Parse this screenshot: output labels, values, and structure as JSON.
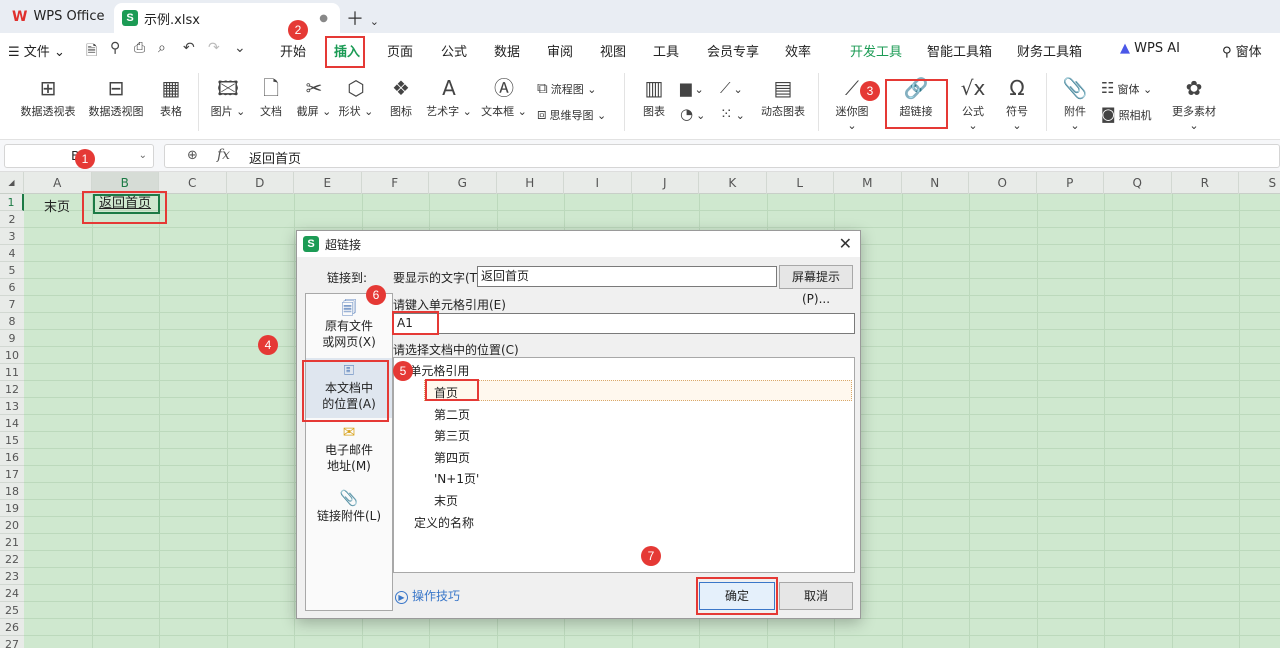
{
  "titlebar": {
    "app": "WPS Office",
    "doc_tab": "示例.xlsx",
    "dot": "●"
  },
  "menu": {
    "file": "文件",
    "items": [
      "开始",
      "插入",
      "页面",
      "公式",
      "数据",
      "审阅",
      "视图",
      "工具",
      "会员专享",
      "效率",
      "开发工具",
      "智能工具箱",
      "财务工具箱"
    ],
    "wps_ai": "WPS AI",
    "form": "窗体"
  },
  "ribbon": {
    "pivot_table": "数据透视表",
    "pivot_view": "数据透视图",
    "table": "表格",
    "picture": "图片",
    "doc": "文档",
    "screenshot": "截屏",
    "shape": "形状",
    "icon": "图标",
    "art_text": "艺术字",
    "textbox": "文本框",
    "flowchart": "流程图",
    "mindmap": "思维导图",
    "chart": "图表",
    "dynamic_chart": "动态图表",
    "sparkline": "迷你图",
    "hyperlink": "超链接",
    "formula": "公式",
    "symbol": "符号",
    "attachment": "附件",
    "form": "窗体",
    "camera": "照相机",
    "more": "更多素材"
  },
  "formula_bar": {
    "name_box": "B1",
    "fx": "fx",
    "value": "返回首页"
  },
  "grid": {
    "columns": [
      "A",
      "B",
      "C",
      "D",
      "E",
      "F",
      "G",
      "H",
      "I",
      "J",
      "K",
      "L",
      "M",
      "N",
      "O",
      "P",
      "Q",
      "R",
      "S"
    ],
    "rows": [
      "1",
      "2",
      "3",
      "4",
      "5",
      "6",
      "7",
      "8",
      "9",
      "10",
      "11",
      "12",
      "13",
      "14",
      "15",
      "16",
      "17",
      "18",
      "19",
      "20",
      "21",
      "22",
      "23",
      "24",
      "25",
      "26",
      "27"
    ],
    "A1": "末页",
    "B1": "返回首页"
  },
  "dialog": {
    "title": "超链接",
    "link_to": "链接到:",
    "display_text_label": "要显示的文字(T):",
    "display_text_value": "返回首页",
    "screen_tip": "屏幕提示(P)...",
    "cell_ref_label": "请键入单元格引用(E)",
    "cell_ref_value": "A1",
    "location_label": "请选择文档中的位置(C)",
    "left_items": [
      "原有文件\n或网页(X)",
      "本文档中\n的位置(A)",
      "电子邮件\n地址(M)",
      "链接附件(L)"
    ],
    "tree_root": "单元格引用",
    "tree_items": [
      "首页",
      "第二页",
      "第三页",
      "第四页",
      "'N+1页'",
      "末页"
    ],
    "defined_names": "定义的名称",
    "tips": "操作技巧",
    "ok": "确定",
    "cancel": "取消"
  },
  "annotations": [
    "1",
    "2",
    "3",
    "4",
    "5",
    "6",
    "7"
  ],
  "colors": {
    "accent_green": "#1c9b55",
    "annotation_red": "#e53935",
    "grid_bg": "#cfe8cf"
  }
}
